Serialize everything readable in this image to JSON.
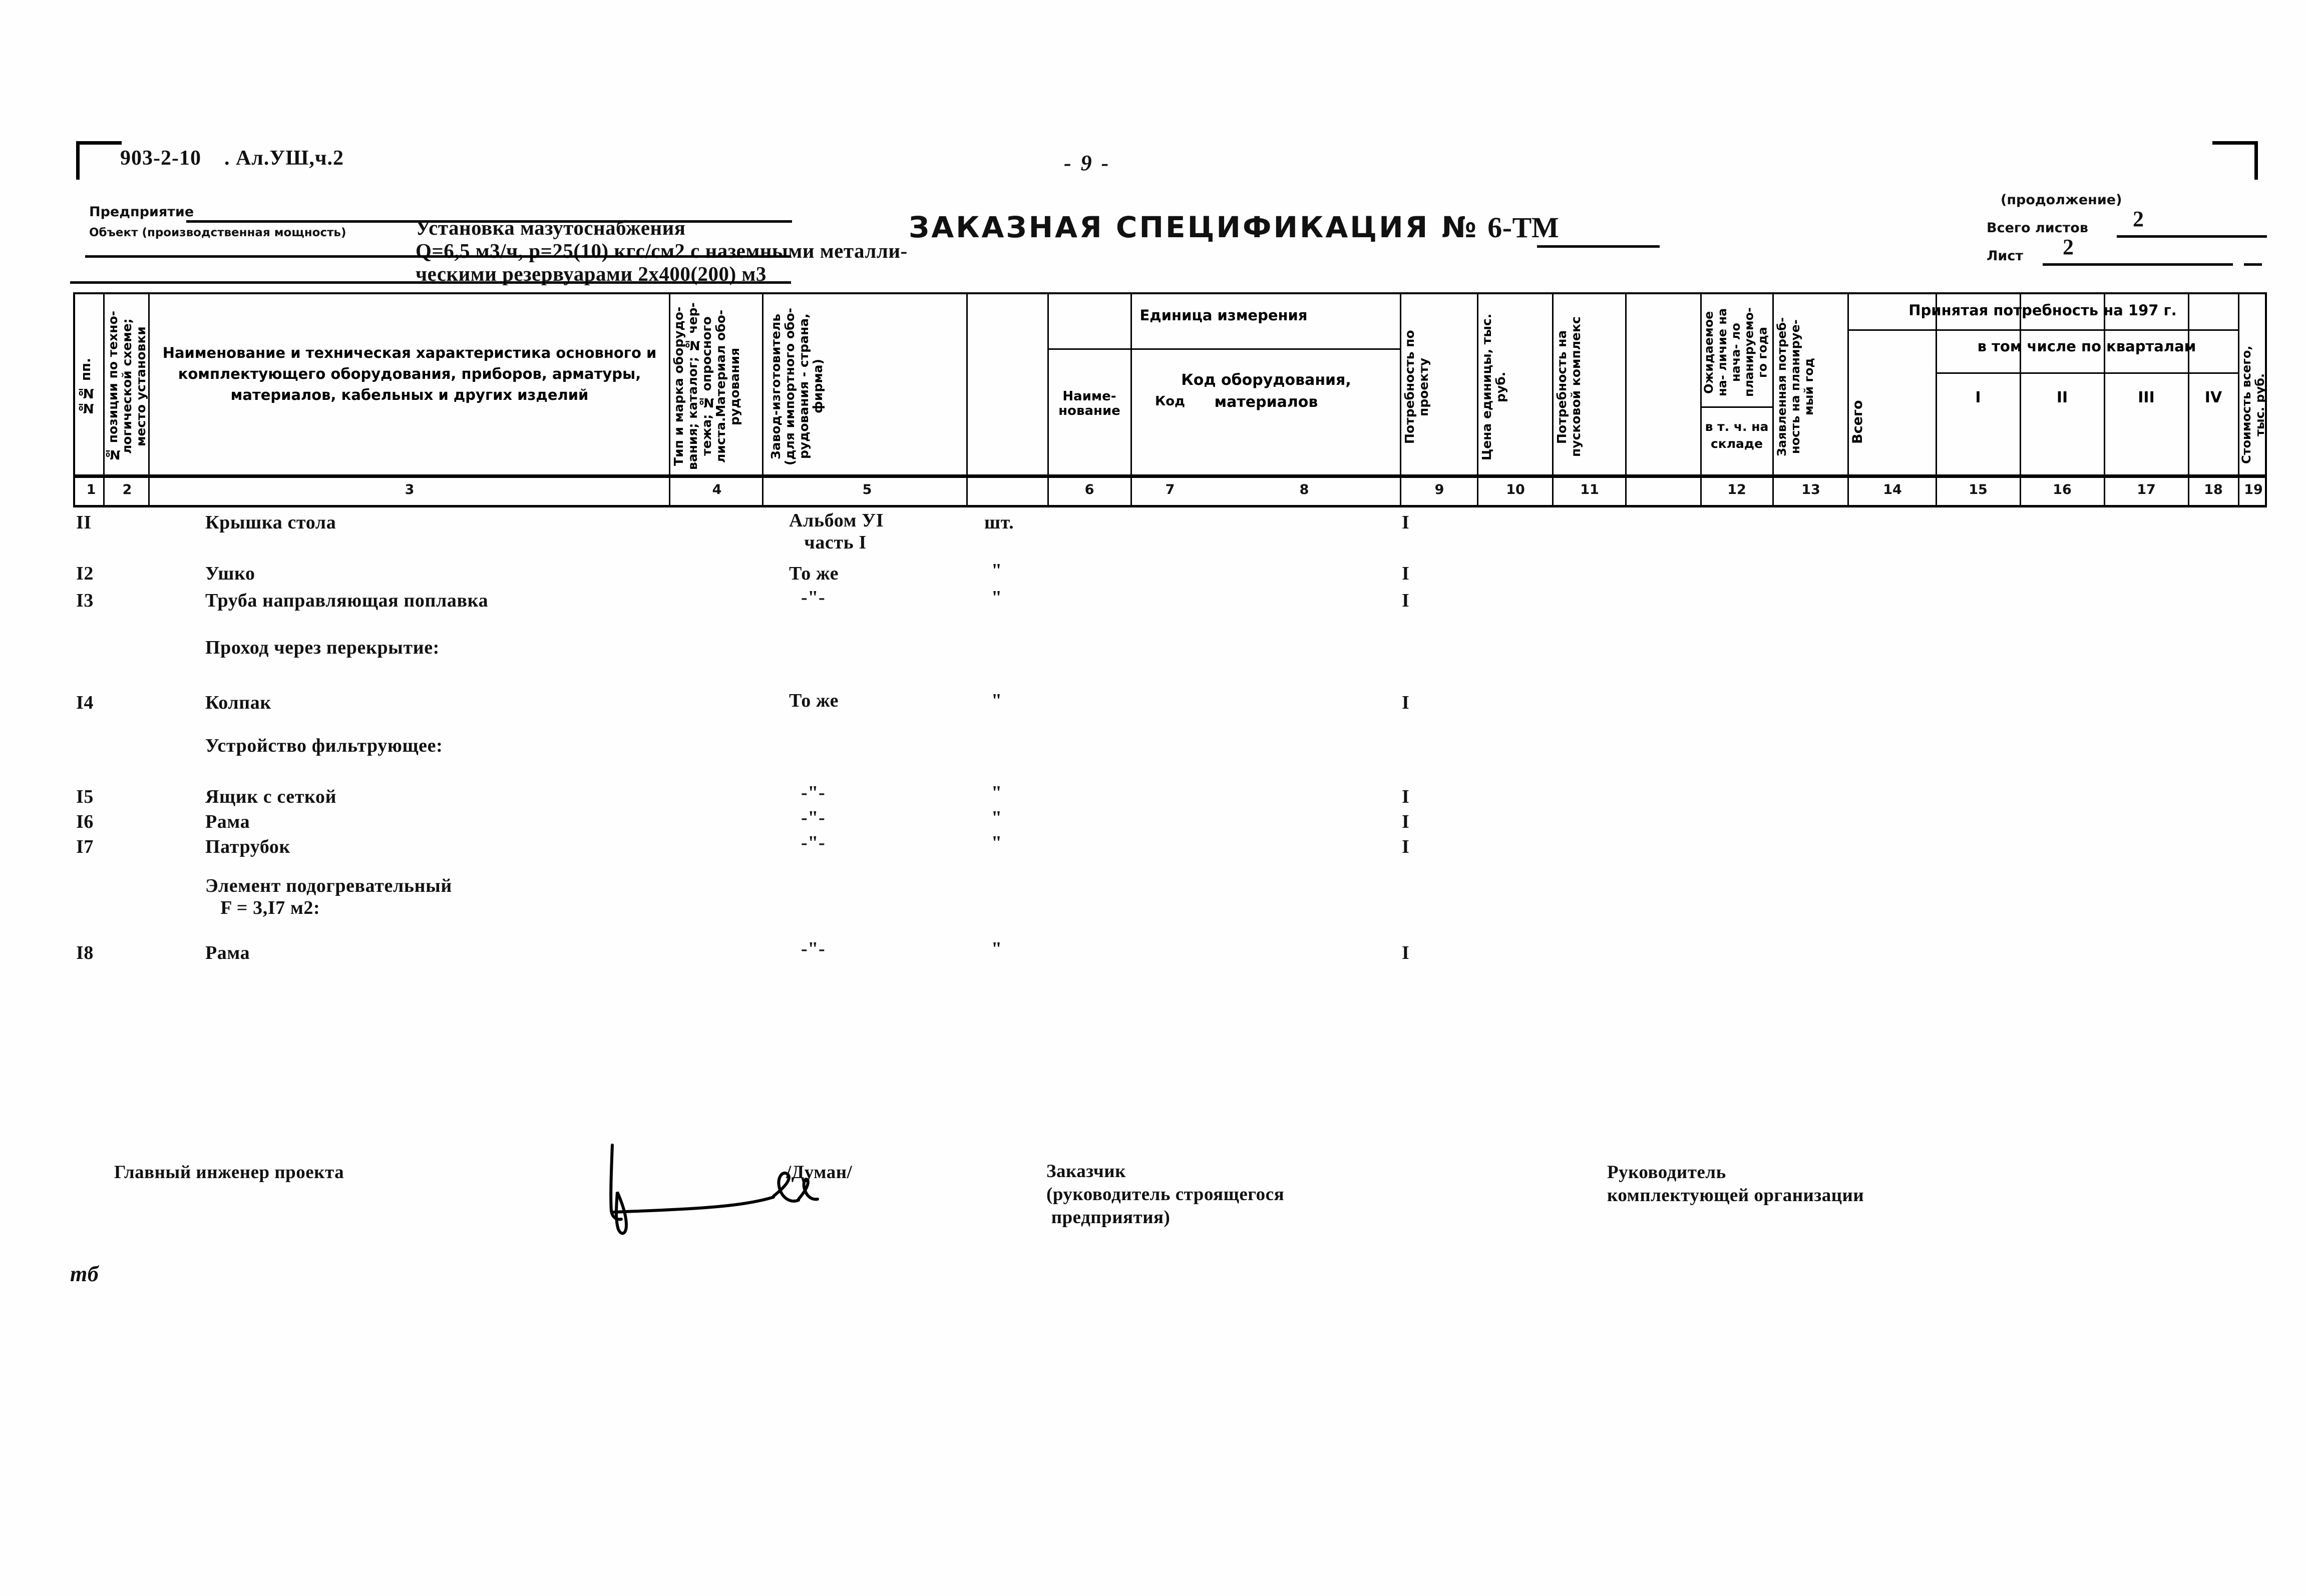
{
  "header": {
    "doc_code": "903-2-10    . Ал.УШ,ч.2",
    "page_number": "9",
    "enterprise_label": "Предприятие",
    "enterprise_value": "",
    "object_label": "Объект (производственная мощность)",
    "object_value": "Установка мазутоснабжения\nQ=6,5 м3/ч, р=25(10) кгс/см2 с наземными металли-\nческими резервуарами 2х400(200) м3",
    "title": "ЗАКАЗНАЯ СПЕЦИФИКАЦИЯ №",
    "title_number": "6-ТМ",
    "continuation": "(продолжение)",
    "total_sheets_label": "Всего листов",
    "total_sheets_value": "2",
    "sheet_label": "Лист",
    "sheet_value": "2"
  },
  "table": {
    "columns": [
      {
        "n": "1",
        "title": "№№ пп."
      },
      {
        "n": "2",
        "title": "№ позиции по техно-\nлогической схеме;\nместо установки"
      },
      {
        "n": "3",
        "title": "Наименование и техническая характеристика\nосновного и комплектующего оборудования,\nприборов, арматуры, материалов, кабельных\nи других изделий"
      },
      {
        "n": "4",
        "title": "Тип и марка оборудо-\nвания; каталог; № чер-\nтежа; № опросного\nлиста.Материал обо-\nрудования"
      },
      {
        "n": "5",
        "title": "Завод-изготовитель\n(для импортного обо-\nрудования - страна,\nфирма)"
      },
      {
        "n": "6",
        "title": "Наиме-\nнование"
      },
      {
        "n": "7",
        "title": "Код"
      },
      {
        "n": "8",
        "title": "Код оборудования,\nматериалов"
      },
      {
        "n": "9",
        "title": "Потребность\nпо проекту"
      },
      {
        "n": "10",
        "title": "Цена единицы,\nтыс. руб."
      },
      {
        "n": "11",
        "title": "Потребность на\nпусковой комплекс"
      },
      {
        "n": "12",
        "title": "в т. ч. на\nскладе"
      },
      {
        "n": "13",
        "title": "Заявленная потреб-\nность на планируе-\nмый год"
      },
      {
        "n": "14",
        "title": "Всего"
      },
      {
        "n": "15",
        "title": "I"
      },
      {
        "n": "16",
        "title": "II"
      },
      {
        "n": "17",
        "title": "III"
      },
      {
        "n": "18",
        "title": "IV"
      },
      {
        "n": "19",
        "title": "Стоимость всего,\nтыс. руб."
      }
    ],
    "group_headers": {
      "unit": "Единица\nизмерения",
      "expected": "Ожидаемое на-\nличие на нача-\nло планируемо-\nго года",
      "accepted": "Принятая потребность на 197     г.",
      "quarters": "в том числе по кварталам"
    },
    "rows": [
      {
        "type": "item",
        "no": "II",
        "name": "Крышка стола",
        "maker": "Альбом УI\n   часть I",
        "unit": "шт.",
        "need": "I"
      },
      {
        "type": "item",
        "no": "I2",
        "name": "Ушко",
        "maker": "То же",
        "unit": "\"",
        "need": "I"
      },
      {
        "type": "item",
        "no": "I3",
        "name": "Труба направляющая поплавка",
        "maker": "-\"-",
        "unit": "\"",
        "need": "I"
      },
      {
        "type": "group",
        "no": "",
        "name": "Проход через перекрытие:",
        "maker": "",
        "unit": "",
        "need": ""
      },
      {
        "type": "item",
        "no": "I4",
        "name": "Колпак",
        "maker": "То же",
        "unit": "\"",
        "need": "I"
      },
      {
        "type": "group",
        "no": "",
        "name": "Устройство фильтрующее:",
        "maker": "",
        "unit": "",
        "need": ""
      },
      {
        "type": "item",
        "no": "I5",
        "name": "Ящик с сеткой",
        "maker": "-\"-",
        "unit": "\"",
        "need": "I"
      },
      {
        "type": "item",
        "no": "I6",
        "name": "Рама",
        "maker": "-\"-",
        "unit": "\"",
        "need": "I"
      },
      {
        "type": "item",
        "no": "I7",
        "name": "Патрубок",
        "maker": "-\"-",
        "unit": "\"",
        "need": "I"
      },
      {
        "type": "group",
        "no": "",
        "name": "Элемент подогревательный\n   F = 3,I7 м2:",
        "maker": "",
        "unit": "",
        "need": ""
      },
      {
        "type": "item",
        "no": "I8",
        "name": "Рама",
        "maker": "-\"-",
        "unit": "\"",
        "need": "I"
      }
    ]
  },
  "signatures": {
    "engineer_label": "Главный инженер проекта",
    "engineer_name": "/Думан/",
    "customer_label": "Заказчик\n(руководитель строящегося\n предприятия)",
    "supplier_label": "Руководитель\nкомплектующей организации"
  },
  "footer": {
    "mark": "тб"
  }
}
